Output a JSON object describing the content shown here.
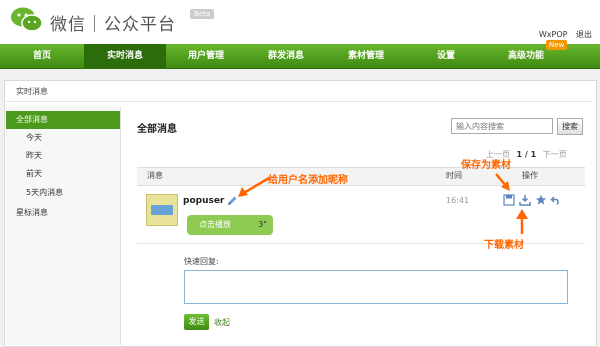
{
  "header": {
    "logo_text": "微信｜公众平台",
    "beta": "Beta",
    "username": "WxPOP",
    "logout": "退出"
  },
  "nav": {
    "items": [
      "首页",
      "实时消息",
      "用户管理",
      "群发消息",
      "素材管理",
      "设置",
      "高级功能"
    ],
    "active_index": 1,
    "new_badge": "New"
  },
  "breadcrumb": "实时消息",
  "sidebar": {
    "items": [
      "全部消息",
      "今天",
      "昨天",
      "前天",
      "5天内消息",
      "星标消息"
    ],
    "active_index": 0
  },
  "main": {
    "title": "全部消息",
    "search_placeholder": "输入内容搜索",
    "search_button": "搜索",
    "pager": {
      "prev": "上一页",
      "current": "1 / 1",
      "next": "下一页"
    },
    "columns": [
      "消息",
      "时间",
      "操作"
    ]
  },
  "message": {
    "username": "popuser",
    "voice_label": "点击播放",
    "voice_duration": "3\"",
    "time": "16:41"
  },
  "reply": {
    "label": "快速回复:",
    "send": "发送",
    "collapse": "收起"
  },
  "annotations": {
    "add_nickname": "给用户名添加昵称",
    "save_material": "保存为素材",
    "download_material": "下载素材"
  },
  "colors": {
    "nav_green": "#4b9a1b",
    "annotation_orange": "#ff6600",
    "voice_bubble": "#8dcb52"
  }
}
